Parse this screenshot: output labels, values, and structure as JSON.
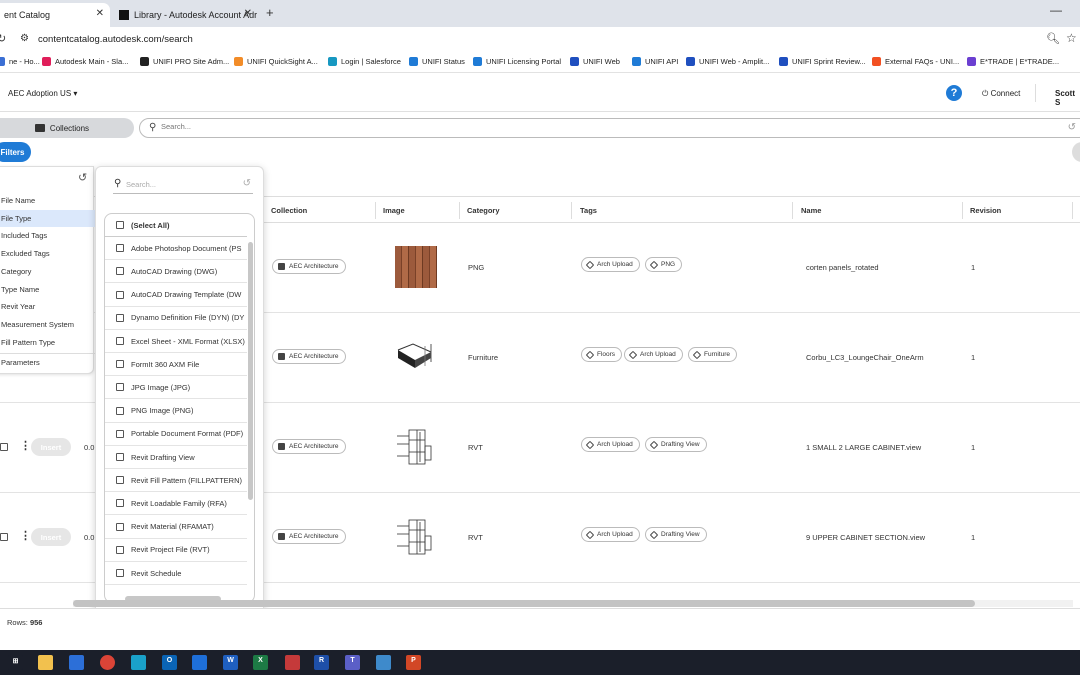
{
  "browser": {
    "tabs": [
      {
        "title": "ent Catalog",
        "close": "✕"
      },
      {
        "title": "Library - Autodesk Account Adr",
        "close": "✕"
      }
    ],
    "new_tab": "+",
    "minimize": "—",
    "url": "contentcatalog.autodesk.com/search"
  },
  "bookmarks": [
    {
      "label": "ne - Ho...",
      "color": "#3b6fd4"
    },
    {
      "label": "Autodesk Main - Sla...",
      "color": "#e01e5a"
    },
    {
      "label": "UNIFI PRO Site Adm...",
      "color": "#222222"
    },
    {
      "label": "UNIFI QuickSight A...",
      "color": "#f28c28"
    },
    {
      "label": "Login | Salesforce",
      "color": "#1798c1"
    },
    {
      "label": "UNIFI Status",
      "color": "#1f7bd6"
    },
    {
      "label": "UNIFI Licensing Portal",
      "color": "#1f7bd6"
    },
    {
      "label": "UNIFI Web",
      "color": "#1f4fbf"
    },
    {
      "label": "UNIFI API",
      "color": "#1f7bd6"
    },
    {
      "label": "UNIFI Web - Amplit...",
      "color": "#1f4fbf"
    },
    {
      "label": "UNIFI Sprint Review...",
      "color": "#1f4fbf"
    },
    {
      "label": "External FAQs - UNI...",
      "color": "#f25022"
    },
    {
      "label": "E*TRADE | E*TRADE...",
      "color": "#6b3fd1"
    }
  ],
  "header": {
    "account": "AEC Adoption US ▾",
    "help": "?",
    "connect": "Connect",
    "user": "Scott S"
  },
  "toolbar": {
    "collections_label": "Collections",
    "search_placeholder": "Search...",
    "filters_label": "Filters"
  },
  "filter_panel": {
    "items": [
      "File Name",
      "File Type",
      "Included Tags",
      "Excluded Tags",
      "Category",
      "Type Name",
      "Revit Year",
      "Measurement System",
      "Fill Pattern Type"
    ],
    "selected": "File Type",
    "parameters": "Parameters"
  },
  "dropdown": {
    "search_placeholder": "Search...",
    "options": [
      "(Select All)",
      "Adobe Photoshop Document (PS",
      "AutoCAD Drawing (DWG)",
      "AutoCAD Drawing Template (DW",
      "Dynamo Definition File (DYN) (DY",
      "Excel Sheet - XML Format (XLSX)",
      "FormIt 360 AXM File",
      "JPG Image (JPG)",
      "PNG Image (PNG)",
      "Portable Document Format (PDF)",
      "Revit Drafting View",
      "Revit Fill Pattern (FILLPATTERN)",
      "Revit Loadable Family (RFA)",
      "Revit Material (RFAMAT)",
      "Revit Project File (RVT)",
      "Revit Schedule"
    ]
  },
  "table": {
    "columns": [
      "Collection",
      "Image",
      "Category",
      "Tags",
      "Name",
      "Revision"
    ],
    "insert_label": "Insert",
    "size_prefix": "0.0",
    "rows": [
      {
        "collection": "AEC Architecture",
        "image": "wood-panel",
        "category": "PNG",
        "tags": [
          "Arch Upload",
          "PNG"
        ],
        "name": "corten panels_rotated",
        "revision": "1"
      },
      {
        "collection": "AEC Architecture",
        "image": "lounge-chair",
        "category": "Furniture",
        "tags": [
          "Floors",
          "Arch Upload",
          "Furniture"
        ],
        "name": "Corbu_LC3_LoungeChair_OneArm",
        "revision": "1"
      },
      {
        "collection": "AEC Architecture",
        "image": "cabinet-section",
        "category": "RVT",
        "tags": [
          "Arch Upload",
          "Drafting View"
        ],
        "name": "1 SMALL 2 LARGE CABINET.view",
        "revision": "1"
      },
      {
        "collection": "AEC Architecture",
        "image": "cabinet-section",
        "category": "RVT",
        "tags": [
          "Arch Upload",
          "Drafting View"
        ],
        "name": "9 UPPER CABINET SECTION.view",
        "revision": "1"
      }
    ]
  },
  "footer": {
    "rows_label": "Rows:",
    "rows_count": "956"
  },
  "taskbar": {
    "icons": [
      {
        "name": "task-view",
        "color": "#1b1f2a",
        "glyph": "⊞"
      },
      {
        "name": "file-explorer",
        "color": "#f2c14e",
        "glyph": ""
      },
      {
        "name": "notes",
        "color": "#2c6fd8",
        "glyph": ""
      },
      {
        "name": "chrome",
        "color": "#db4437",
        "glyph": ""
      },
      {
        "name": "edge",
        "color": "#1aa1c9",
        "glyph": ""
      },
      {
        "name": "outlook",
        "color": "#0a64b5",
        "glyph": "O"
      },
      {
        "name": "people",
        "color": "#1e6fd9",
        "glyph": ""
      },
      {
        "name": "word",
        "color": "#1f5fbf",
        "glyph": "W"
      },
      {
        "name": "excel",
        "color": "#1d7a45",
        "glyph": "X"
      },
      {
        "name": "snipping",
        "color": "#c53a3a",
        "glyph": ""
      },
      {
        "name": "revit",
        "color": "#1e4fa8",
        "glyph": "R"
      },
      {
        "name": "teams",
        "color": "#5b5fc7",
        "glyph": "T"
      },
      {
        "name": "dynamo",
        "color": "#3e8acb",
        "glyph": ""
      },
      {
        "name": "powerpoint",
        "color": "#d24726",
        "glyph": "P"
      }
    ]
  }
}
